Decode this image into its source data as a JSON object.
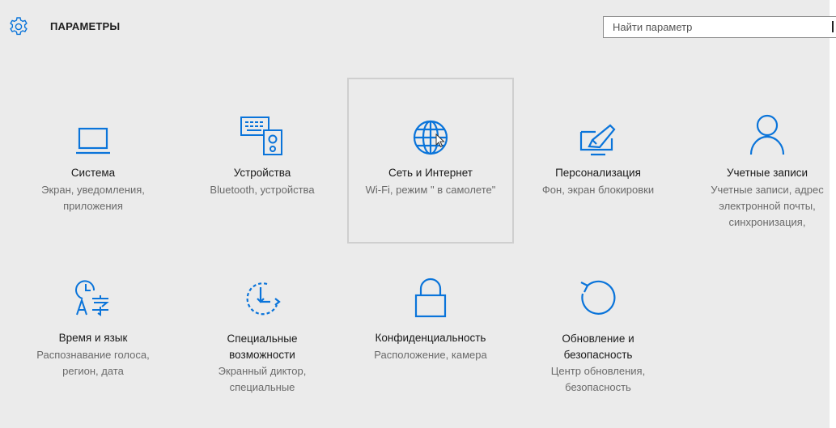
{
  "header": {
    "title": "ПАРАМЕТРЫ",
    "gear_icon": "gear-icon",
    "search_placeholder": "Найти параметр"
  },
  "colors": {
    "accent": "#0a74da",
    "background": "#ebebeb",
    "text": "#1a1a1a",
    "secondary_text": "#6a6a6a"
  },
  "tiles": [
    {
      "name": "Система",
      "desc": "Экран, уведомления, приложения",
      "icon": "laptop-icon"
    },
    {
      "name": "Устройства",
      "desc": "Bluetooth, устройства",
      "icon": "devices-icon"
    },
    {
      "name": "Сеть и Интернет",
      "desc": "Wi-Fi, режим \" в самолете\"",
      "icon": "globe-icon",
      "selected": true
    },
    {
      "name": "Персонализация",
      "desc": "Фон, экран блокировки",
      "icon": "paint-icon"
    },
    {
      "name": "Учетные записи",
      "desc": "Учетные записи, адрес электронной почты, синхронизация,",
      "icon": "person-icon"
    },
    {
      "name": "Время и язык",
      "desc": "Распознавание голоса, регион, дата",
      "icon": "time-language-icon"
    },
    {
      "name": "Специальные возможности",
      "desc": "Экранный диктор, специальные",
      "icon": "accessibility-icon"
    },
    {
      "name": "Конфиденциальность",
      "desc": "Расположение, камера",
      "icon": "lock-icon"
    },
    {
      "name": "Обновление и безопасность",
      "desc": "Центр обновления, безопасность",
      "icon": "update-icon"
    }
  ]
}
